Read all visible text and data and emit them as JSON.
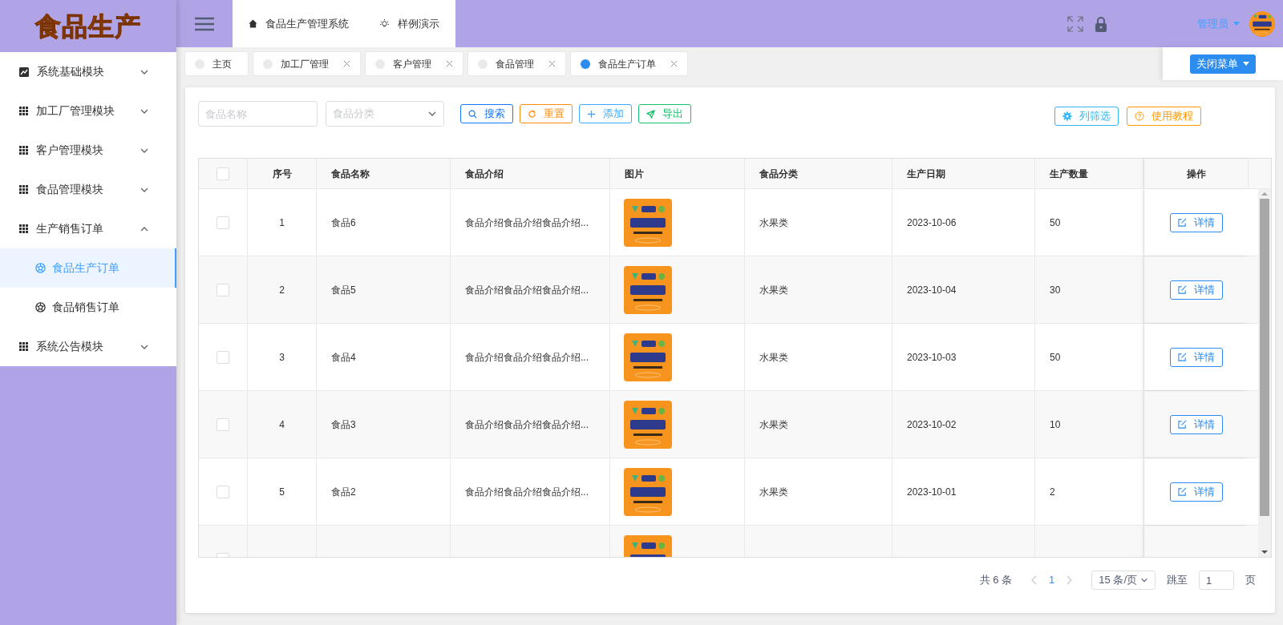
{
  "logo": {
    "text": "食品生产"
  },
  "top_nav": [
    {
      "label": "食品生产管理系统",
      "kind": "home"
    },
    {
      "label": "样例演示",
      "kind": "bulb"
    }
  ],
  "user": {
    "name": "管理员"
  },
  "sidebar": {
    "items": [
      {
        "label": "系统基础模块",
        "kind": "chart",
        "expanded": false
      },
      {
        "label": "加工厂管理模块",
        "kind": "grid",
        "expanded": false
      },
      {
        "label": "客户管理模块",
        "kind": "grid",
        "expanded": false
      },
      {
        "label": "食品管理模块",
        "kind": "grid",
        "expanded": false
      },
      {
        "label": "生产销售订单",
        "kind": "grid",
        "expanded": true,
        "children": [
          {
            "label": "食品生产订单",
            "selected": true
          },
          {
            "label": "食品销售订单",
            "selected": false
          }
        ]
      },
      {
        "label": "系统公告模块",
        "kind": "grid",
        "expanded": false
      }
    ]
  },
  "tags": [
    {
      "label": "主页",
      "closable": false,
      "selected": false
    },
    {
      "label": "加工厂管理",
      "closable": true,
      "selected": false
    },
    {
      "label": "客户管理",
      "closable": true,
      "selected": false
    },
    {
      "label": "食品管理",
      "closable": true,
      "selected": false
    },
    {
      "label": "食品生产订单",
      "closable": true,
      "selected": true
    }
  ],
  "close_menu": "关闭菜单",
  "filters": [
    {
      "kind": "input",
      "placeholder": "食品名称"
    },
    {
      "kind": "select",
      "placeholder": "食品分类"
    }
  ],
  "actions": [
    {
      "label": "搜索",
      "kind": "search"
    },
    {
      "label": "重置",
      "kind": "reset"
    },
    {
      "label": "添加",
      "kind": "add"
    },
    {
      "label": "导出",
      "kind": "export"
    }
  ],
  "right_actions": [
    {
      "label": "列筛选",
      "kind": "columns"
    },
    {
      "label": "使用教程",
      "kind": "help"
    }
  ],
  "table": {
    "select_all_checked": false,
    "columns": [
      "序号",
      "食品名称",
      "食品介绍",
      "图片",
      "食品分类",
      "生产日期",
      "生产数量",
      "操作"
    ],
    "rows": [
      {
        "checked": false,
        "cells": [
          "1",
          "食品6",
          "食品介绍食品介绍食品介绍...",
          "",
          "水果类",
          "2023-10-06",
          "50"
        ],
        "action": "详情"
      },
      {
        "checked": false,
        "cells": [
          "2",
          "食品5",
          "食品介绍食品介绍食品介绍...",
          "",
          "水果类",
          "2023-10-04",
          "30"
        ],
        "action": "详情"
      },
      {
        "checked": false,
        "cells": [
          "3",
          "食品4",
          "食品介绍食品介绍食品介绍...",
          "",
          "水果类",
          "2023-10-03",
          "50"
        ],
        "action": "详情"
      },
      {
        "checked": false,
        "cells": [
          "4",
          "食品3",
          "食品介绍食品介绍食品介绍...",
          "",
          "水果类",
          "2023-10-02",
          "10"
        ],
        "action": "详情"
      },
      {
        "checked": false,
        "cells": [
          "5",
          "食品2",
          "食品介绍食品介绍食品介绍...",
          "",
          "水果类",
          "2023-10-01",
          "2"
        ],
        "action": "详情"
      },
      {
        "checked": false
      }
    ]
  },
  "pagination": {
    "total": "共 6 条",
    "pages": [
      {
        "label": "1",
        "selected": true
      }
    ],
    "page_size": "15 条/页",
    "jump_label": "跳至",
    "jump_value": "1",
    "page_unit": "页"
  }
}
